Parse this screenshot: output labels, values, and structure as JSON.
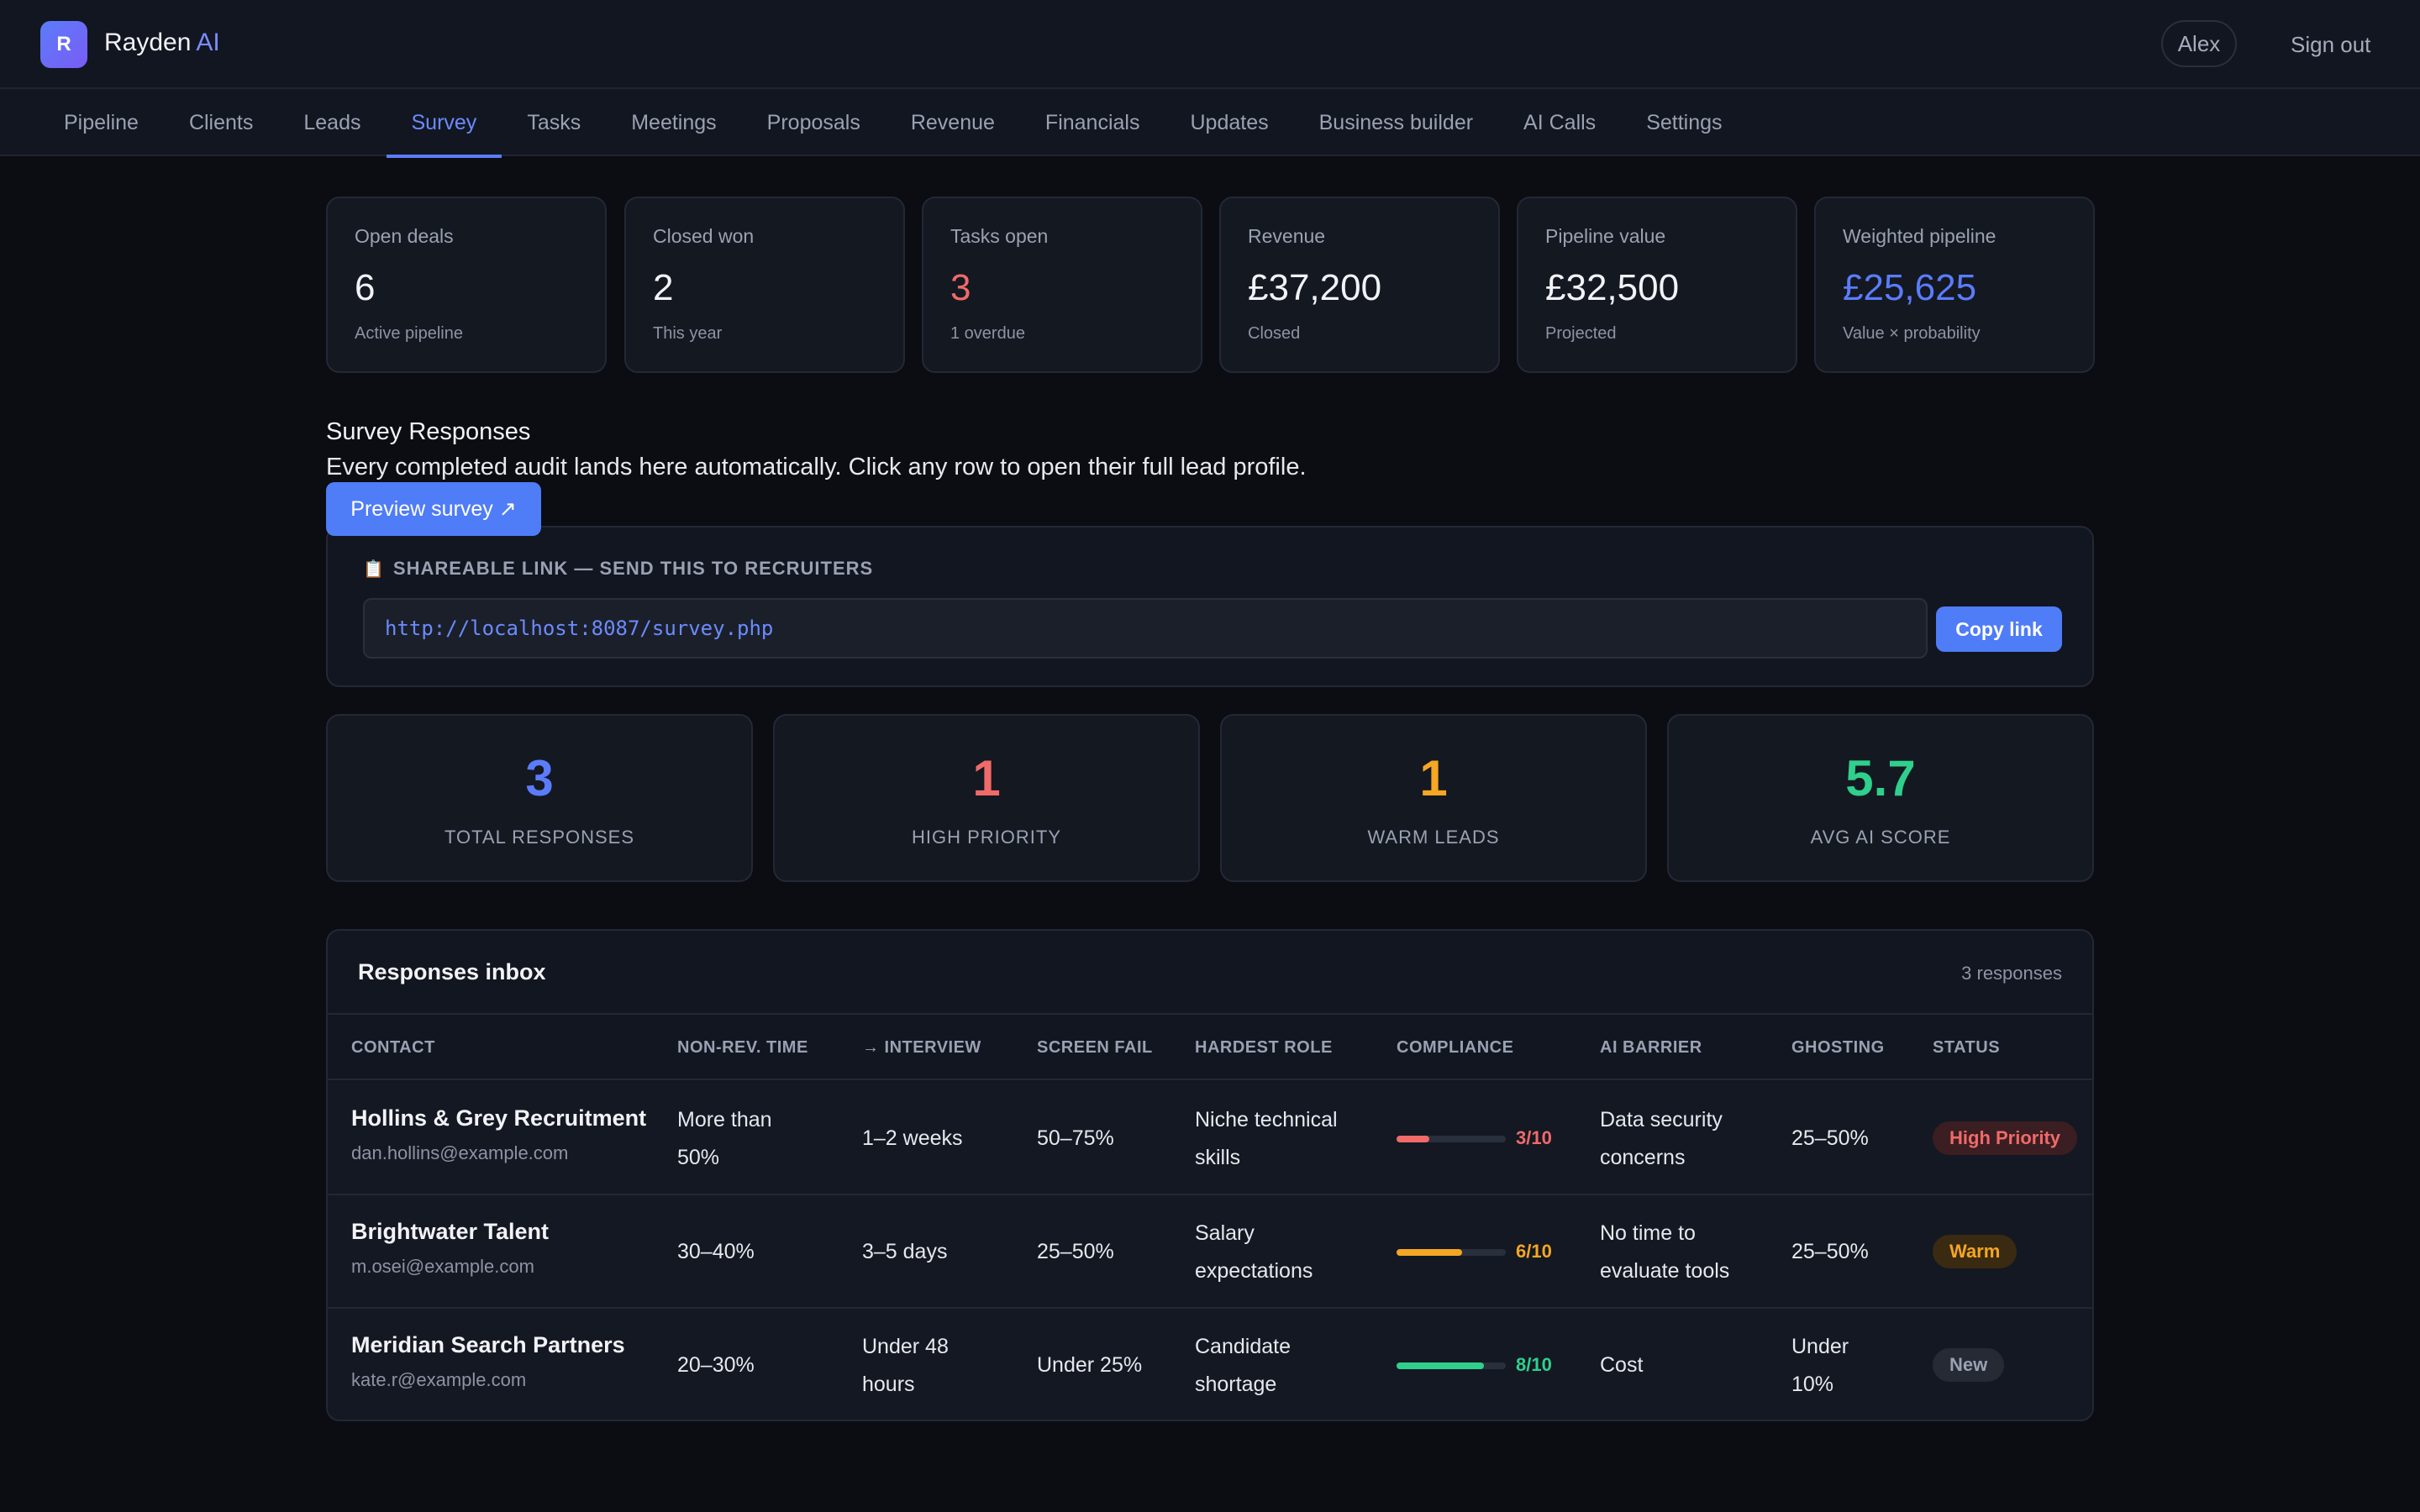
{
  "header": {
    "logo_letter": "R",
    "brand_name": "Rayden",
    "brand_suffix": "AI",
    "user": "Alex",
    "sign_out": "Sign out"
  },
  "nav": {
    "items": [
      "Pipeline",
      "Clients",
      "Leads",
      "Survey",
      "Tasks",
      "Meetings",
      "Proposals",
      "Revenue",
      "Financials",
      "Updates",
      "Business builder",
      "AI Calls",
      "Settings"
    ],
    "active": "Survey"
  },
  "stats": [
    {
      "label": "Open deals",
      "value": "6",
      "sub": "Active pipeline"
    },
    {
      "label": "Closed won",
      "value": "2",
      "sub": "This year"
    },
    {
      "label": "Tasks open",
      "value": "3",
      "sub": "1 overdue"
    },
    {
      "label": "Revenue",
      "value": "£37,200",
      "sub": "Closed"
    },
    {
      "label": "Pipeline value",
      "value": "£32,500",
      "sub": "Projected"
    },
    {
      "label": "Weighted pipeline",
      "value": "£25,625",
      "sub": "Value × probability"
    }
  ],
  "survey": {
    "title": "Survey Responses",
    "description": "Every completed audit lands here automatically. Click any row to open their full lead profile.",
    "preview_button": "Preview survey ↗",
    "share_label": "SHAREABLE LINK — SEND THIS TO RECRUITERS",
    "share_link": "http://localhost:8087/survey.php",
    "copy_button": "Copy link"
  },
  "metrics": [
    {
      "value": "3",
      "label": "TOTAL RESPONSES",
      "color": "#5b7cfa"
    },
    {
      "value": "1",
      "label": "HIGH PRIORITY",
      "color": "#f06a6a"
    },
    {
      "value": "1",
      "label": "WARM LEADS",
      "color": "#f5a623"
    },
    {
      "value": "5.7",
      "label": "AVG AI SCORE",
      "color": "#2fcf8c"
    }
  ],
  "inbox": {
    "title": "Responses inbox",
    "count": "3 responses",
    "columns": [
      "CONTACT",
      "NON-REV. TIME",
      "→ INTERVIEW",
      "SCREEN FAIL",
      "HARDEST ROLE",
      "COMPLIANCE",
      "AI BARRIER",
      "GHOSTING",
      "STATUS"
    ],
    "rows": [
      {
        "name": "Hollins & Grey Recruitment",
        "email": "dan.hollins@example.com",
        "non_rev_time": [
          "More than",
          "50%"
        ],
        "interview": [
          "1–2 weeks"
        ],
        "screen_fail": "50–75%",
        "hardest_role": [
          "Niche technical",
          "skills"
        ],
        "compliance": 3,
        "compliance_text": "3/10",
        "ai_barrier": [
          "Data security",
          "concerns"
        ],
        "ghosting": [
          "25–50%"
        ],
        "status": "High Priority"
      },
      {
        "name": "Brightwater Talent",
        "email": "m.osei@example.com",
        "non_rev_time": [
          "30–40%"
        ],
        "interview": [
          "3–5 days"
        ],
        "screen_fail": "25–50%",
        "hardest_role": [
          "Salary",
          "expectations"
        ],
        "compliance": 6,
        "compliance_text": "6/10",
        "ai_barrier": [
          "No time to",
          "evaluate tools"
        ],
        "ghosting": [
          "25–50%"
        ],
        "status": "Warm"
      },
      {
        "name": "Meridian Search Partners",
        "email": "kate.r@example.com",
        "non_rev_time": [
          "20–30%"
        ],
        "interview": [
          "Under 48",
          "hours"
        ],
        "screen_fail": "Under 25%",
        "hardest_role": [
          "Candidate",
          "shortage"
        ],
        "compliance": 8,
        "compliance_text": "8/10",
        "ai_barrier": [
          "Cost"
        ],
        "ghosting": [
          "Under",
          "10%"
        ],
        "status": "New"
      }
    ]
  },
  "colors": {
    "accent": "#5b7cfa",
    "danger": "#f06a6a",
    "warm": "#f5a623",
    "success": "#2fcf8c",
    "background": "#0b0d12"
  }
}
